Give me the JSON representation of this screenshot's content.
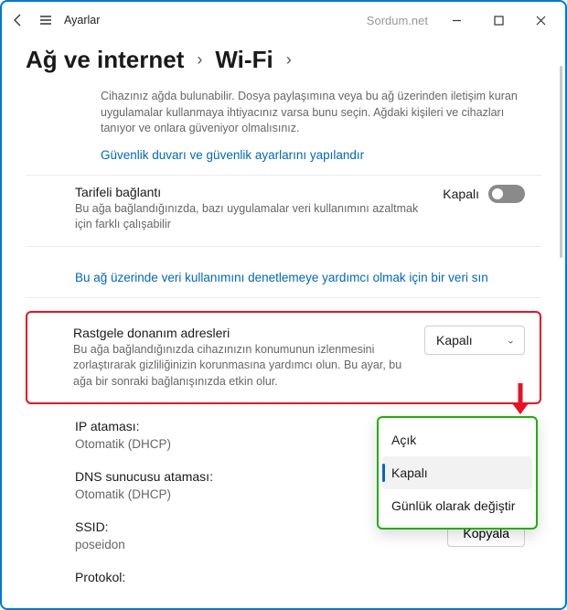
{
  "titlebar": {
    "app_label": "Ayarlar",
    "watermark": "Sordum.net"
  },
  "breadcrumb": {
    "level1": "Ağ ve internet",
    "level2": "Wi-Fi"
  },
  "discoverability": {
    "desc": "Cihazınız ağda bulunabilir. Dosya paylaşımına veya bu ağ üzerinden iletişim kuran uygulamalar kullanmaya ihtiyacınız varsa bunu seçin. Ağdaki kişileri ve cihazları tanıyor ve onlara güveniyor olmalısınız.",
    "link": "Güvenlik duvarı ve güvenlik ayarlarını yapılandır"
  },
  "metered": {
    "title": "Tarifeli bağlantı",
    "desc": "Bu ağa bağlandığınızda, bazı uygulamalar veri kullanımını azaltmak için farklı çalışabilir",
    "toggle_label": "Kapalı"
  },
  "data_limit_link": "Bu ağ üzerinde veri kullanımını denetlemeye yardımcı olmak için bir veri sın",
  "random_mac": {
    "title": "Rastgele donanım adresleri",
    "desc": "Bu ağa bağlandığınızda cihazınızın konumunun izlenmesini zorlaştırarak gizliliğinizin korunmasına yardımcı olun. Bu ayar, bu ağa bir sonraki bağlanışınızda etkin olur.",
    "selected": "Kapalı"
  },
  "dropdown_options": {
    "opt1": "Açık",
    "opt2": "Kapalı",
    "opt3": "Günlük olarak değiştir"
  },
  "ip": {
    "label": "IP ataması:",
    "value": "Otomatik (DHCP)"
  },
  "dns": {
    "label": "DNS sunucusu ataması:",
    "value": "Otomatik (DHCP)"
  },
  "ssid": {
    "label": "SSID:",
    "value": "poseidon",
    "copy_label": "Kopyala"
  },
  "protokol": {
    "label": "Protokol:"
  }
}
